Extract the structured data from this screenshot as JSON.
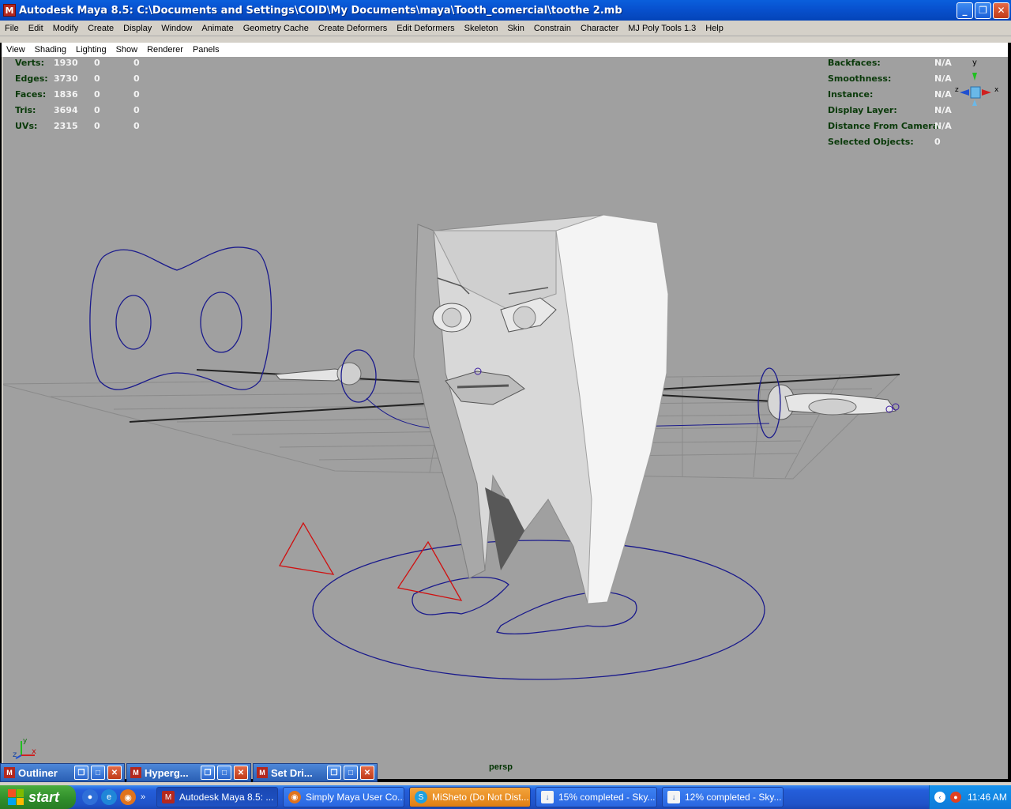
{
  "window": {
    "title": "Autodesk Maya 8.5: C:\\Documents and Settings\\COID\\My Documents\\maya\\Tooth_comercial\\toothe 2.mb",
    "min_glyph": "_",
    "max_glyph": "❐",
    "close_glyph": "✕"
  },
  "main_menu": [
    "File",
    "Edit",
    "Modify",
    "Create",
    "Display",
    "Window",
    "Animate",
    "Geometry Cache",
    "Create Deformers",
    "Edit Deformers",
    "Skeleton",
    "Skin",
    "Constrain",
    "Character",
    "MJ Poly Tools 1.3",
    "Help"
  ],
  "panel_menu": [
    "View",
    "Shading",
    "Lighting",
    "Show",
    "Renderer",
    "Panels"
  ],
  "hud_left": [
    {
      "label": "Verts:",
      "v1": "1930",
      "v2": "0",
      "v3": "0"
    },
    {
      "label": "Edges:",
      "v1": "3730",
      "v2": "0",
      "v3": "0"
    },
    {
      "label": "Faces:",
      "v1": "1836",
      "v2": "0",
      "v3": "0"
    },
    {
      "label": "Tris:",
      "v1": "3694",
      "v2": "0",
      "v3": "0"
    },
    {
      "label": "UVs:",
      "v1": "2315",
      "v2": "0",
      "v3": "0"
    }
  ],
  "hud_right": [
    {
      "label": "Backfaces:",
      "value": "N/A"
    },
    {
      "label": "Smoothness:",
      "value": "N/A"
    },
    {
      "label": "Instance:",
      "value": "N/A"
    },
    {
      "label": "Display Layer:",
      "value": "N/A"
    },
    {
      "label": "Distance From Camera:",
      "value": "N/A"
    },
    {
      "label": "Selected Objects:",
      "value": "0"
    }
  ],
  "view_cube": {
    "y": "y",
    "x": "x",
    "z": "z"
  },
  "axis_indicator": {
    "y": "y",
    "z": "z",
    "x": "x"
  },
  "camera_label": "persp",
  "minimized_windows": [
    "Outliner",
    "Hyperg...",
    "Set Dri..."
  ],
  "taskbar": {
    "start_label": "start",
    "overflow": "»",
    "tasks": [
      {
        "label": "Autodesk Maya 8.5: ...",
        "icon": "maya-icon",
        "state": "active"
      },
      {
        "label": "Simply Maya User Co...",
        "icon": "firefox-icon",
        "state": "normal"
      },
      {
        "label": "MiSheto (Do Not Dist...",
        "icon": "skype-icon",
        "state": "flash"
      },
      {
        "label": "15% completed - Sky...",
        "icon": "download-icon",
        "state": "normal"
      },
      {
        "label": "12% completed - Sky...",
        "icon": "download-icon",
        "state": "normal"
      }
    ],
    "clock": "11:46 AM"
  },
  "colors": {
    "xp_blue": "#0852d0",
    "viewport_bg": "#a0a0a0",
    "hud_label": "#0a3a0a",
    "curve_blue": "#1a1a8c",
    "locator_red": "#d01010"
  }
}
